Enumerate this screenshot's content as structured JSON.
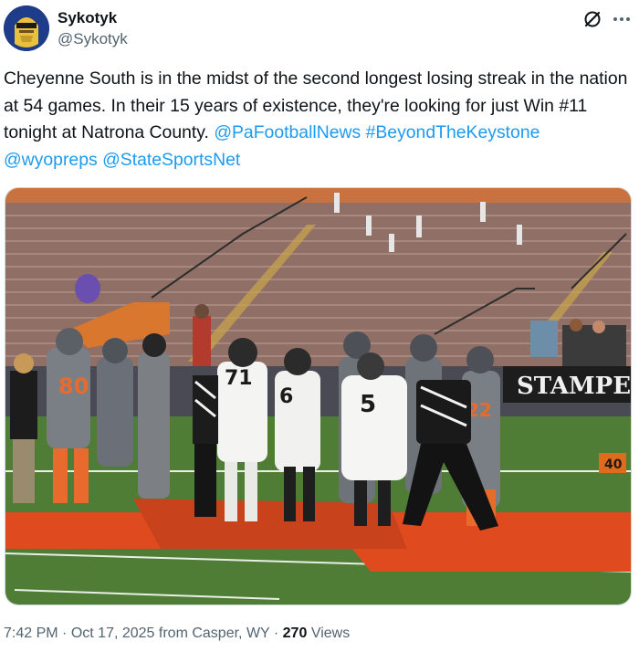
{
  "author": {
    "display_name": "Sykotyk",
    "handle": "@Sykotyk"
  },
  "tweet": {
    "text_intro": "Cheyenne South is in the midst of the second longest losing streak in the nation at 54 games. In their 15 years of existence, they're looking for just Win #11 tonight at Natrona County. ",
    "mentions": [
      "@PaFootballNews",
      "#BeyondTheKeystone",
      "@wyopreps",
      "@StateSportsNet"
    ]
  },
  "media": {
    "jersey_numbers": [
      "80",
      "71",
      "6",
      "5",
      "22"
    ],
    "banner_text": "STAMPE",
    "yard_marker": "40",
    "colors": {
      "turf": "#4f7d36",
      "paint_orange": "#e04a1f",
      "bleacher": "#8f6f66",
      "team_orange": "#e86a2c"
    }
  },
  "meta": {
    "time": "7:42 PM",
    "date": "Oct 17, 2025",
    "location": "from Casper, WY",
    "separator": "·",
    "views_count": "270",
    "views_label": "Views"
  },
  "icons": {
    "grok": "grok-icon",
    "more": "more-options-icon",
    "avatar": "avatar-image"
  }
}
